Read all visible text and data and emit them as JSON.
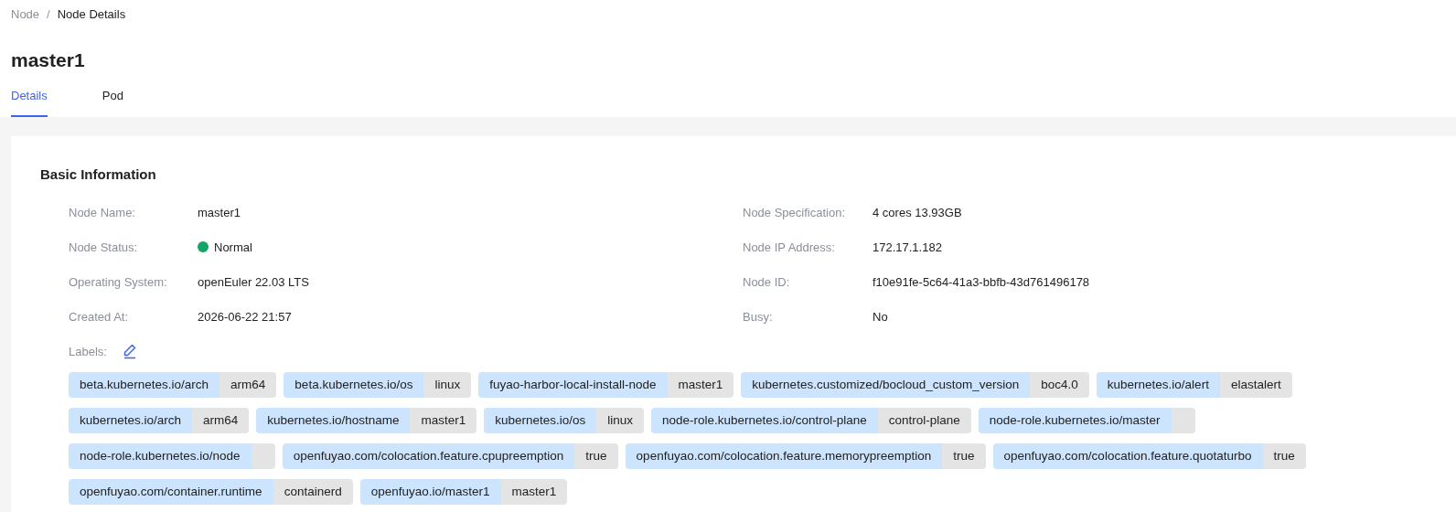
{
  "breadcrumb": [
    {
      "label": "Node",
      "current": false
    },
    {
      "label": "Node Details",
      "current": true
    }
  ],
  "breadcrumb_separator": "/",
  "title": "master1",
  "tabs": [
    {
      "label": "Details",
      "selected": true
    },
    {
      "label": "Pod",
      "selected": false
    }
  ],
  "section": {
    "title": "Basic Information",
    "fields": [
      {
        "label": "Node Name:",
        "value": "master1"
      },
      {
        "label": "Node Specification:",
        "value": "4 cores 13.93GB"
      },
      {
        "label": "Node Status:",
        "value": "Normal",
        "color": "#13a566"
      },
      {
        "label": "Node IP Address:",
        "value": "172.17.1.182"
      },
      {
        "label": "Operating System:",
        "value": "openEuler 22.03 LTS"
      },
      {
        "label": "Node ID:",
        "value": "f10e91fe-5c64-41a3-bbfb-43d761496178"
      },
      {
        "label": "Created At:",
        "value": "2026-06-22 21:57"
      },
      {
        "label": "Busy:",
        "value": "No"
      }
    ],
    "labels_title": "Labels:",
    "labels": [
      {
        "key": "beta.kubernetes.io/arch",
        "value": "arm64"
      },
      {
        "key": "beta.kubernetes.io/os",
        "value": "linux"
      },
      {
        "key": "fuyao-harbor-local-install-node",
        "value": "master1"
      },
      {
        "key": "kubernetes.customized/bocloud_custom_version",
        "value": "boc4.0"
      },
      {
        "key": "kubernetes.io/alert",
        "value": "elastalert"
      },
      {
        "key": "kubernetes.io/arch",
        "value": "arm64"
      },
      {
        "key": "kubernetes.io/hostname",
        "value": "master1"
      },
      {
        "key": "kubernetes.io/os",
        "value": "linux"
      },
      {
        "key": "node-role.kubernetes.io/control-plane",
        "value": "control-plane"
      },
      {
        "key": "node-role.kubernetes.io/master"
      },
      {
        "key": "node-role.kubernetes.io/node"
      },
      {
        "key": "openfuyao.com/colocation.feature.cpupreemption",
        "value": "true"
      },
      {
        "key": "openfuyao.com/colocation.feature.memorypreemption",
        "value": "true"
      },
      {
        "key": "openfuyao.com/colocation.feature.quotaturbo",
        "value": "true"
      },
      {
        "key": "openfuyao.com/container.runtime",
        "value": "containerd"
      },
      {
        "key": "openfuyao.io/master1",
        "value": "master1"
      }
    ]
  }
}
